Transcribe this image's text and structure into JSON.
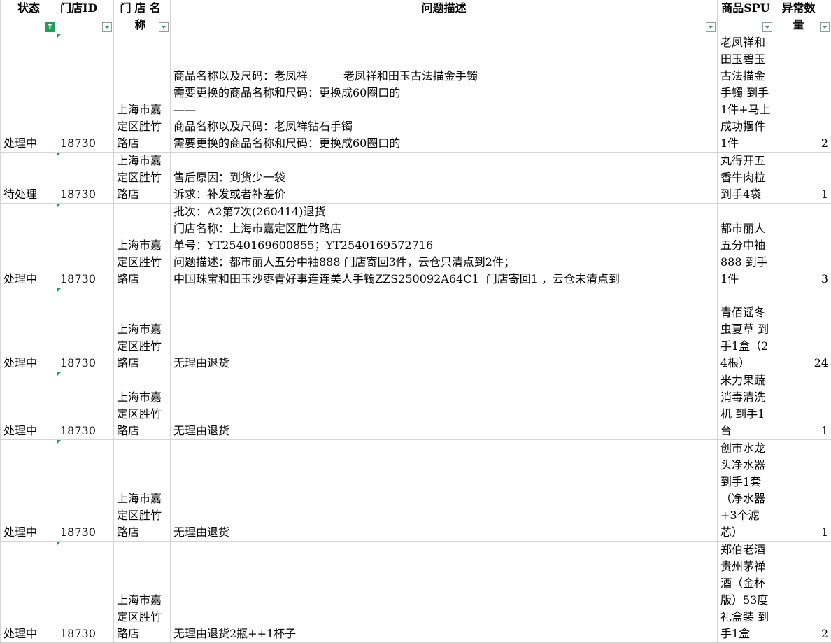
{
  "headers": {
    "status": "状态",
    "store_id": "门店ID",
    "store_name": "门店名称",
    "description": "问题描述",
    "spu": "商品SPU",
    "qty": "异常数量"
  },
  "rows": [
    {
      "status": "处理中",
      "store_id": "18730",
      "store_name": "上海市嘉定区胜竹路店",
      "description": "商品名称以及尺码：老凤祥          老凤祥和田玉古法描金手镯\n需要更换的商品名称和尺码：更换成60圈口的\n——\n商品名称以及尺码：老凤祥钻石手镯\n需要更换的商品名称和尺码：更换成60圈口的",
      "spu": "老凤祥和田玉碧玉古法描金手镯 到手1件+马上成功摆件1件",
      "qty": "2"
    },
    {
      "status": "待处理",
      "store_id": "18730",
      "store_name": "上海市嘉定区胜竹路店",
      "description": "售后原因：到货少一袋\n诉求：补发或者补差价",
      "spu": "丸得开五香牛肉粒到手4袋",
      "qty": "1"
    },
    {
      "status": "处理中",
      "store_id": "18730",
      "store_name": "上海市嘉定区胜竹路店",
      "description": "批次：A2第7次(260414)退货\n门店名称：上海市嘉定区胜竹路店\n单号：YT2540169600855；YT2540169572716\n问题描述：都市丽人五分中袖888 门店寄回3件，云仓只清点到2件；\n中国珠宝和田玉沙枣青好事连连美人手镯ZZS250092A64C1  门店寄回1 ，云仓未清点到",
      "spu": "都市丽人五分中袖888 到手1件",
      "qty": "3"
    },
    {
      "status": "处理中",
      "store_id": "18730",
      "store_name": "上海市嘉定区胜竹路店",
      "description": "无理由退货",
      "spu": "青佰谣冬虫夏草 到手1盒（24根）",
      "qty": "24"
    },
    {
      "status": "处理中",
      "store_id": "18730",
      "store_name": "上海市嘉定区胜竹路店",
      "description": "无理由退货",
      "spu": "米力果蔬消毒清洗机 到手1台",
      "qty": "1"
    },
    {
      "status": "处理中",
      "store_id": "18730",
      "store_name": "上海市嘉定区胜竹路店",
      "description": "无理由退货",
      "spu": "创市水龙头净水器 到手1套（净水器+3个滤芯）",
      "qty": "1"
    },
    {
      "status": "处理中",
      "store_id": "18730",
      "store_name": "上海市嘉定区胜竹路店",
      "description": "无理由退货2瓶++1杯子",
      "spu": "郑伯老酒贵州茅禅酒（金杯版）53度礼盒装 到手1盒",
      "qty": "2"
    }
  ],
  "colors": {
    "filter_accent": "#1f9e5a",
    "gridline": "#d4d4d4"
  },
  "icons": {
    "filter_active": "filter-funnel-icon",
    "filter_dropdown": "dropdown-arrow-icon",
    "comment_marker": "cell-indicator-icon"
  }
}
